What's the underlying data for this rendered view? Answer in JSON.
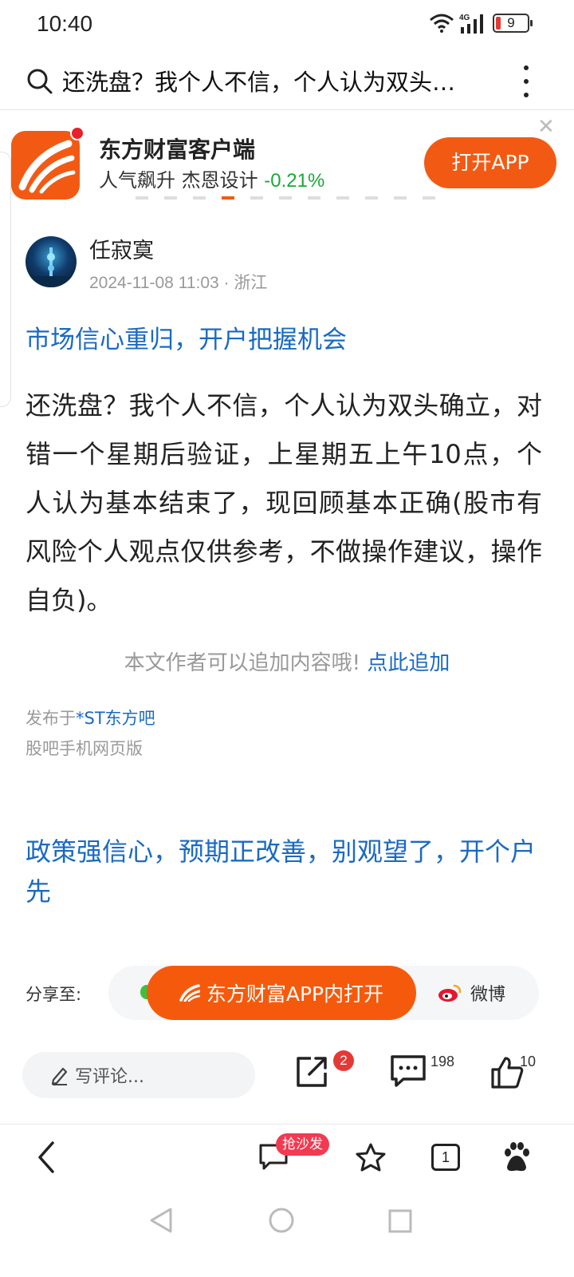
{
  "status_bar": {
    "time": "10:40",
    "network": "4G",
    "battery": "9"
  },
  "header": {
    "title": "还洗盘？我个人不信，个人认为双头…"
  },
  "app_banner": {
    "app_name": "东方财富客户端",
    "ticker_name": "人气飙升  杰恩设计",
    "ticker_change": "-0.21%",
    "open_button": "打开APP",
    "change_color": "#1aa839",
    "accent_color": "#f25a14"
  },
  "post": {
    "author": "任寂寞",
    "meta": "2024-11-08 11:03 · 浙江",
    "link_headline": "市场信心重归，开户把握机会",
    "body": "还洗盘？我个人不信，个人认为双头确立，对错一个星期后验证，上星期五上午10点，个人认为基本结束了，现回顾基本正确(股市有风险个人观点仅供参考，不做操作建议，操作自负)。",
    "append_text": "本文作者可以追加内容哦!",
    "append_link": "点此追加",
    "published_in_prefix": "发布于",
    "forum": "*ST东方吧",
    "mobile_web": "股吧手机网页版",
    "promo_headline": "政策强信心，预期正改善，别观望了，开个户先"
  },
  "share": {
    "label": "分享至:",
    "open_in_app": "东方财富APP内打开",
    "weibo": "微博"
  },
  "actions": {
    "comment_placeholder": "写评论...",
    "share_badge": "2",
    "comment_count": "198",
    "like_count": "10"
  },
  "browser_bar": {
    "sofa_badge": "抢沙发",
    "tab_count": "1"
  },
  "link_color": "#1a6ac2"
}
